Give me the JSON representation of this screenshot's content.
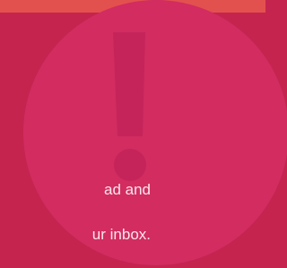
{
  "banner": {
    "accent_color": "#e3514f",
    "background_color": "#c5244f",
    "circle_color": "#d22c61",
    "icon": "exclamation-icon",
    "message_lines": [
      "ad and",
      "ur inbox."
    ]
  }
}
